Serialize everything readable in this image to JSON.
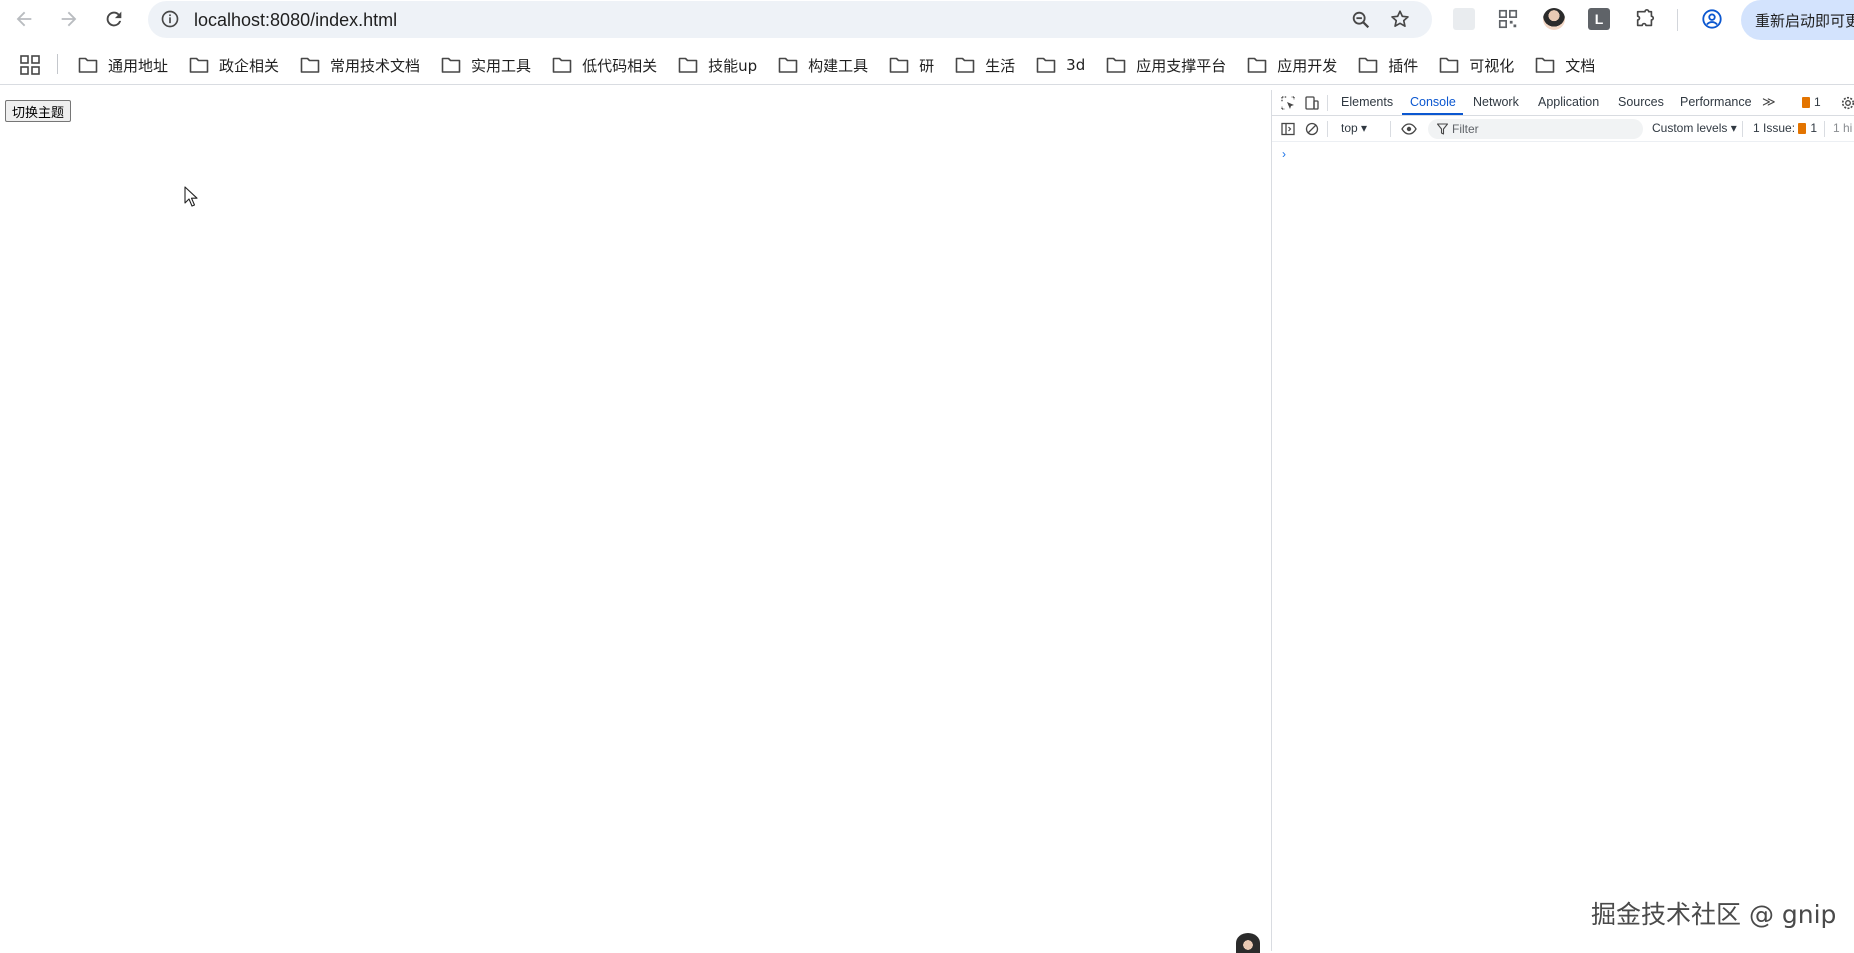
{
  "browser": {
    "url": "localhost:8080/index.html",
    "restart_label": "重新启动即可更新"
  },
  "bookmarks": [
    {
      "label": "通用地址"
    },
    {
      "label": "政企相关"
    },
    {
      "label": "常用技术文档"
    },
    {
      "label": "实用工具"
    },
    {
      "label": "低代码相关"
    },
    {
      "label": "技能up"
    },
    {
      "label": "构建工具"
    },
    {
      "label": "研"
    },
    {
      "label": "生活"
    },
    {
      "label": "3d"
    },
    {
      "label": "应用支撑平台"
    },
    {
      "label": "应用开发"
    },
    {
      "label": "插件"
    },
    {
      "label": "可视化"
    },
    {
      "label": "文档"
    }
  ],
  "page": {
    "theme_button_label": "切换主题"
  },
  "devtools": {
    "tabs": [
      {
        "label": "Elements"
      },
      {
        "label": "Console"
      },
      {
        "label": "Network"
      },
      {
        "label": "Application"
      },
      {
        "label": "Sources"
      },
      {
        "label": "Performance"
      }
    ],
    "active_tab": "Console",
    "issue_badge_count": "1",
    "context": "top",
    "filter_placeholder": "Filter",
    "levels": "Custom levels",
    "issues_label": "1 Issue:",
    "issues_count": "1",
    "hidden_label": "1 hi",
    "prompt": "›",
    "accent_color": "#0b57d0"
  },
  "watermark": "掘金技术社区 @ gnip"
}
